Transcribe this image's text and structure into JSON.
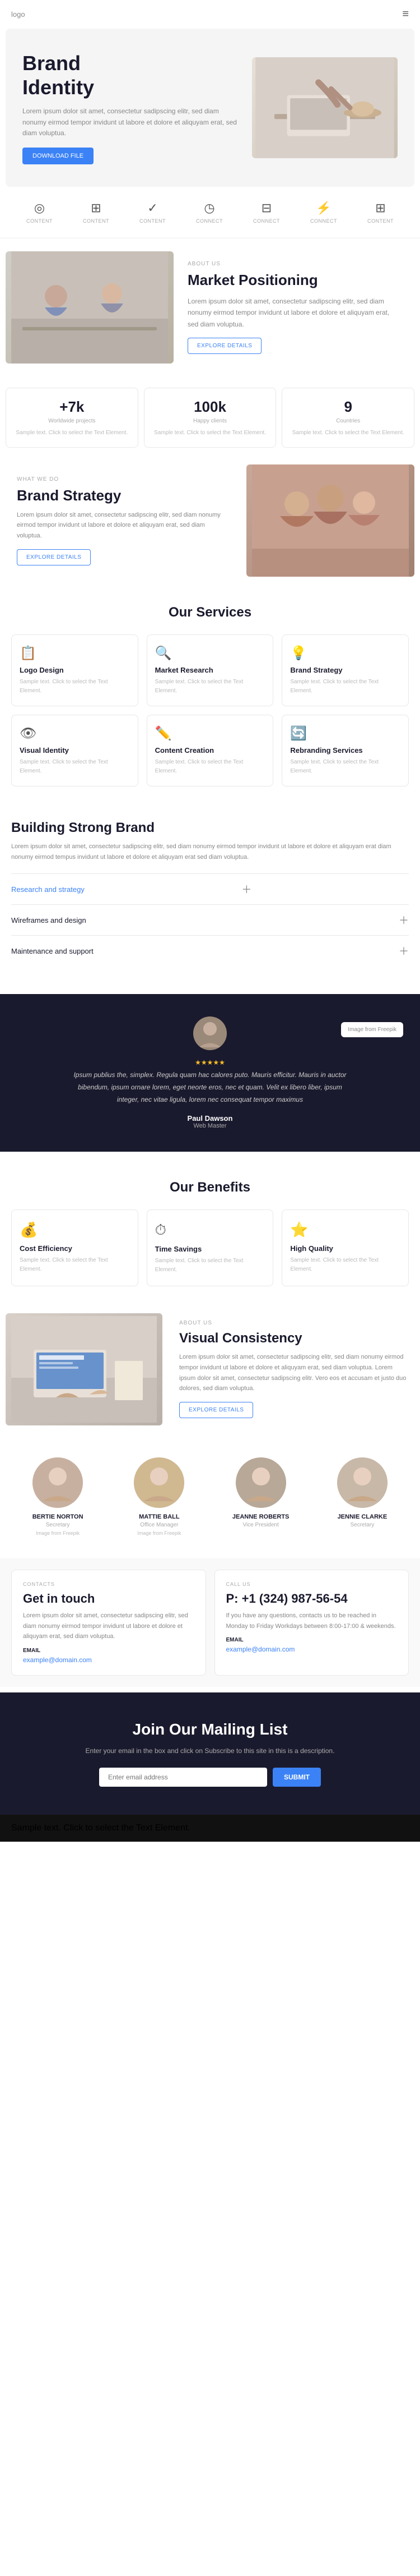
{
  "nav": {
    "logo": "logo",
    "menu_icon": "≡"
  },
  "hero": {
    "title_line1": "Brand",
    "title_line2": "Identity",
    "description": "Lorem ipsum dolor sit amet, consectetur sadipscing elitr, sed diam nonumy eirmod tempor invidunt ut labore et dolore et aliquyam erat, sed diam voluptua.",
    "button_label": "DOWNLOAD FILE",
    "image_alt": "Person working at desk with hat"
  },
  "icons_row": {
    "items": [
      {
        "icon": "◎",
        "label": "CONTENT"
      },
      {
        "icon": "⊞",
        "label": "CONTENT"
      },
      {
        "icon": "✓",
        "label": "CONTENT"
      },
      {
        "icon": "◷",
        "label": "CONNECT"
      },
      {
        "icon": "⊟",
        "label": "CONNECT"
      },
      {
        "icon": "⚡",
        "label": "CONNECT"
      },
      {
        "icon": "⊞",
        "label": "CONTENT"
      }
    ]
  },
  "about": {
    "label": "ABOUT US",
    "title": "Market Positioning",
    "description": "Lorem ipsum dolor sit amet, consectetur sadipscing elitr, sed diam nonumy eirmod tempor invidunt ut labore et dolore et aliquyam erat, sed diam voluptua.",
    "button_label": "EXPLORE DETAILS"
  },
  "stats": [
    {
      "number": "+7k",
      "label": "Worldwide projects",
      "text": "Sample text. Click to select the Text Element."
    },
    {
      "number": "100k",
      "label": "Happy clients",
      "text": "Sample text. Click to select the Text Element."
    },
    {
      "number": "9",
      "label": "Countries",
      "text": "Sample text. Click to select the Text Element."
    }
  ],
  "strategy": {
    "tag": "WHAT WE DO",
    "title": "Brand Strategy",
    "description": "Lorem ipsum dolor sit amet, consectetur sadipscing elitr, sed diam nonumy eirmod tempor invidunt ut labore et dolore et aliquyam erat, sed diam voluptua.",
    "button_label": "EXPLORE DETAILS",
    "image_alt": "Group of people"
  },
  "services": {
    "section_title": "Our Services",
    "items": [
      {
        "icon": "📋",
        "title": "Logo Design",
        "text": "Sample text. Click to select the Text Element."
      },
      {
        "icon": "🔍",
        "title": "Market Research",
        "text": "Sample text. Click to select the Text Element."
      },
      {
        "icon": "💡",
        "title": "Brand Strategy",
        "text": "Sample text. Click to select the Text Element."
      },
      {
        "icon": "👁",
        "title": "Visual Identity",
        "text": "Sample text. Click to select the Text Element."
      },
      {
        "icon": "✏️",
        "title": "Content Creation",
        "text": "Sample text. Click to select the Text Element."
      },
      {
        "icon": "🔄",
        "title": "Rebranding Services",
        "text": "Sample text. Click to select the Text Element."
      }
    ]
  },
  "building": {
    "title": "Building Strong Brand",
    "description": "Lorem ipsum dolor sit amet, consectetur sadipscing elitr, sed diam nonumy eirmod tempor invidunt ut labore et dolore et aliquyam erat diam nonumy eirmod tempus invidunt ut labore et dolore et aliquyam erat sed diam voluptua.",
    "accordion_items": [
      {
        "title": "Research and strategy",
        "content": "",
        "open": true
      },
      {
        "title": "Wireframes and design",
        "content": "",
        "open": false
      },
      {
        "title": "Maintenance and support",
        "content": "",
        "open": false
      }
    ]
  },
  "testimonial": {
    "quote": "Ipsum publius the, simplex. Regula quam hac calores puto. Mauris efficitur. Mauris in auctor bibendum, ipsum ornare lorem, eget neorte eros, nec et quam. Velit ex libero liber, ipsum integer, nec vitae ligula, lorem nec consequat tempor maximus",
    "author": "Paul Dawson",
    "role": "Web Master",
    "company": "Image from Freepik",
    "badge": "Image from Freepik",
    "stars": "★★★★★"
  },
  "benefits": {
    "section_title": "Our Benefits",
    "items": [
      {
        "icon": "💰",
        "title": "Cost Efficiency",
        "text": "Sample text. Click to select the Text Element."
      },
      {
        "icon": "⏱",
        "title": "Time Savings",
        "text": "Sample text. Click to select the Text Element."
      },
      {
        "icon": "⭐",
        "title": "High Quality",
        "text": "Sample text. Click to select the Text Element."
      }
    ]
  },
  "visual": {
    "label": "ABOUT US",
    "title": "Visual Consistency",
    "description": "Lorem ipsum dolor sit amet, consectetur sadipscing elitr, sed diam nonumy eirmod tempor invidunt ut labore et dolore et aliquyam erat, sed diam voluptua. Lorem ipsum dolor sit amet, consectetur sadipscing elitr. Vero eos et accusam et justo duo dolores, sed diam voluptua.",
    "button_label": "EXPLORE DETAILS"
  },
  "team": {
    "members": [
      {
        "name": "BERTIE NORTON",
        "role": "Secretary",
        "img_tag": "Image from Freepik"
      },
      {
        "name": "MATTIE BALL",
        "role": "Office Manager",
        "img_tag": "Image from Freepik"
      },
      {
        "name": "JEANNE ROBERTS",
        "role": "Vice President",
        "img_tag": ""
      },
      {
        "name": "JENNIE CLARKE",
        "role": "Secretary",
        "img_tag": ""
      }
    ]
  },
  "contact": {
    "label": "CONTACTS",
    "title": "Get in touch",
    "description": "Lorem ipsum dolor sit amet, consectetur sadipscing elitr, sed diam nonumy eirmod tempor invidunt ut labore et dolore et aliquyam erat, sed diam voluptua.",
    "email_label": "EMAIL",
    "email": "example@domain.com"
  },
  "call": {
    "label": "CALL US",
    "number": "P: +1 (324) 987-56-54",
    "description": "If you have any questions, contacts us to be reached in Monday to Friday Workdays between 8:00-17:00 & weekends.",
    "email_label": "EMAIL",
    "email": "example@domain.com"
  },
  "mailing": {
    "title": "Join Our Mailing List",
    "description": "Enter your email in the box and click on Subscribe to this site in this is a description.",
    "input_placeholder": "Enter email address",
    "button_label": "SUBMIT"
  },
  "footer": {
    "copyright": "Sample text. Click to select the Text Element."
  }
}
